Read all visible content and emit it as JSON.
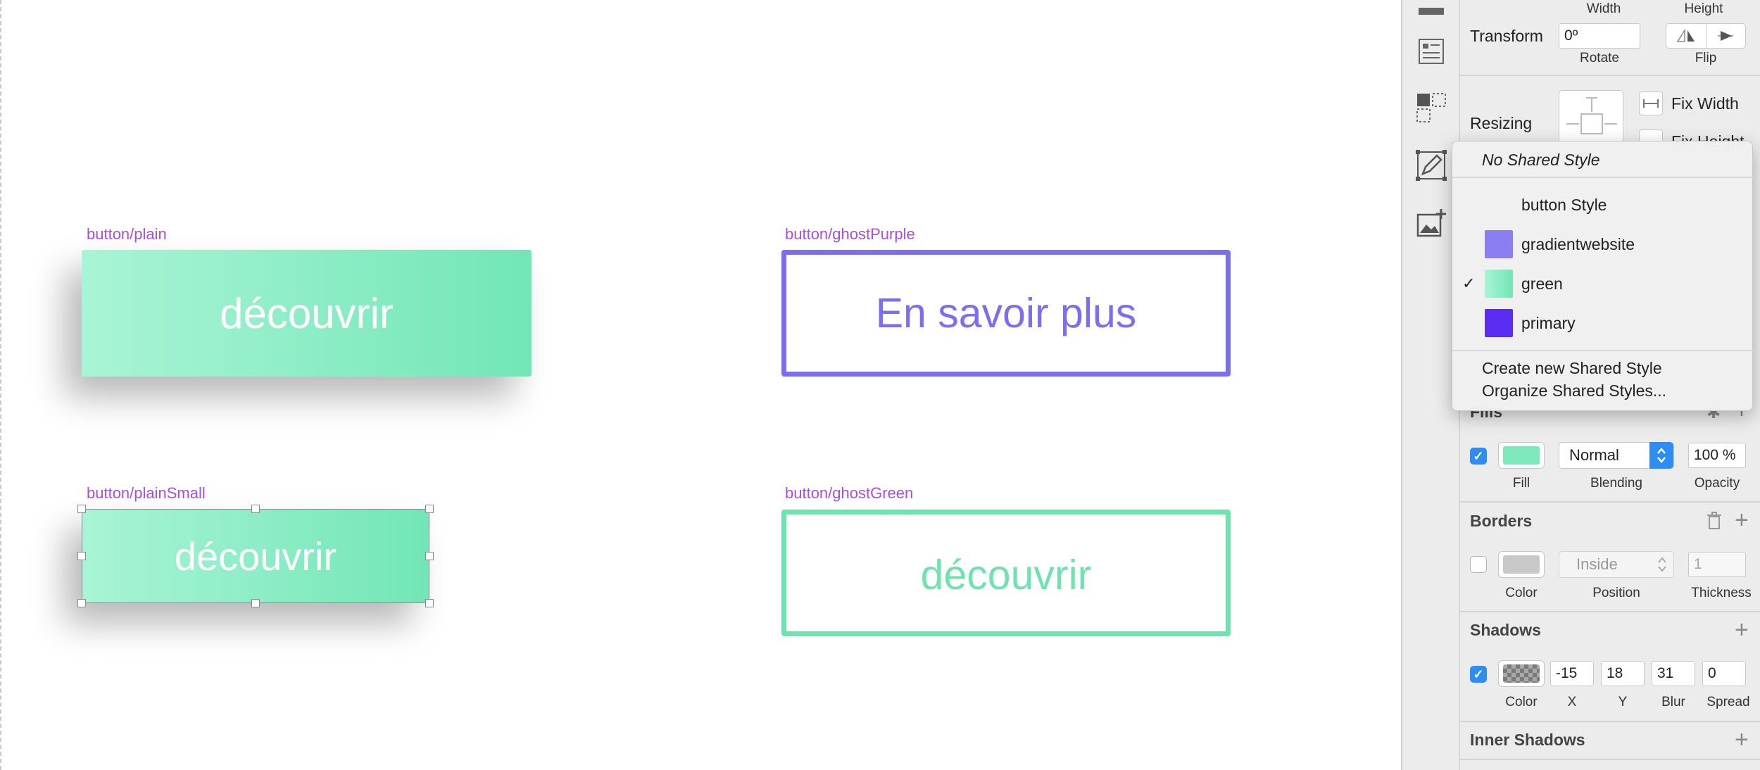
{
  "canvas": {
    "artboards": [
      {
        "label": "button/plain",
        "button_text": "découvrir"
      },
      {
        "label": "button/ghostPurple",
        "button_text": "En savoir plus",
        "color": "#7a6ff0"
      },
      {
        "label": "button/plainSmall",
        "button_text": "découvrir"
      },
      {
        "label": "button/ghostGreen",
        "button_text": "découvrir",
        "color": "#6fe3ad"
      }
    ]
  },
  "inspector": {
    "transform": {
      "width_label": "Width",
      "height_label": "Height",
      "row_label": "Transform",
      "rotate_value": "0º",
      "rotate_label": "Rotate",
      "flip_label": "Flip"
    },
    "resizing": {
      "row_label": "Resizing",
      "fix_width": "Fix Width",
      "fix_height": "Fix Height"
    },
    "fills": {
      "title": "Fills",
      "blending_value": "Normal",
      "opacity_value": "100 %",
      "fill_label": "Fill",
      "blending_label": "Blending",
      "opacity_label": "Opacity",
      "fill_color": "#7ee8bd"
    },
    "borders": {
      "title": "Borders",
      "position_value": "Inside",
      "thickness_value": "1",
      "color_label": "Color",
      "position_label": "Position",
      "thickness_label": "Thickness"
    },
    "shadows": {
      "title": "Shadows",
      "x": "-15",
      "y": "18",
      "blur": "31",
      "spread": "0",
      "color_label": "Color",
      "x_label": "X",
      "y_label": "Y",
      "blur_label": "Blur",
      "spread_label": "Spread"
    },
    "inner_shadows": {
      "title": "Inner Shadows"
    }
  },
  "shared_style_menu": {
    "no_style": "No Shared Style",
    "items": [
      {
        "label": "button Style",
        "swatch": null,
        "checked": false
      },
      {
        "label": "gradientwebsite",
        "swatch": "#8b7df2",
        "checked": false
      },
      {
        "label": "green",
        "swatch": "#86ecc2",
        "checked": true
      },
      {
        "label": "primary",
        "swatch": "#5b2cf2",
        "checked": false
      }
    ],
    "check_mark": "✓",
    "create": "Create new Shared Style",
    "organize": "Organize Shared Styles..."
  }
}
